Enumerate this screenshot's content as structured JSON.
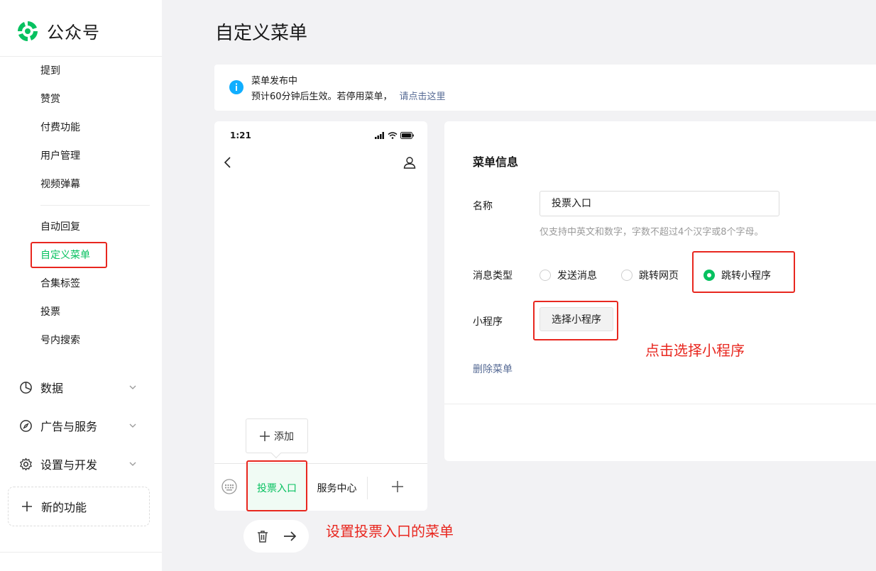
{
  "brand": {
    "name": "公众号",
    "color": "#07c160",
    "logo_icon": "wechat-official-logo"
  },
  "sidebar": {
    "items": [
      {
        "label": "提到",
        "active": false
      },
      {
        "label": "赞赏",
        "active": false
      },
      {
        "label": "付费功能",
        "active": false
      },
      {
        "label": "用户管理",
        "active": false
      },
      {
        "label": "视频弹幕",
        "active": false
      },
      {
        "label": "自动回复",
        "active": false
      },
      {
        "label": "自定义菜单",
        "active": true
      },
      {
        "label": "合集标签",
        "active": false
      },
      {
        "label": "投票",
        "active": false
      },
      {
        "label": "号内搜索",
        "active": false
      }
    ],
    "sections": [
      {
        "label": "数据",
        "icon": "pie-chart-icon"
      },
      {
        "label": "广告与服务",
        "icon": "compass-icon"
      },
      {
        "label": "设置与开发",
        "icon": "gear-icon"
      }
    ],
    "new_feature": "新的功能"
  },
  "page": {
    "title": "自定义菜单"
  },
  "notice": {
    "title": "菜单发布中",
    "desc": "预计60分钟后生效。若停用菜单，",
    "link": "请点击这里"
  },
  "phone": {
    "time": "1:21",
    "menus": [
      {
        "label": "投票入口",
        "selected": true
      },
      {
        "label": "服务中心",
        "selected": false
      }
    ],
    "add_label": "添加"
  },
  "form": {
    "section_title": "菜单信息",
    "name_label": "名称",
    "name_value": "投票入口",
    "name_hint": "仅支持中英文和数字，字数不超过4个汉字或8个字母。",
    "type_label": "消息类型",
    "types": [
      {
        "label": "发送消息",
        "checked": false
      },
      {
        "label": "跳转网页",
        "checked": false
      },
      {
        "label": "跳转小程序",
        "checked": true
      }
    ],
    "miniprogram_label": "小程序",
    "miniprogram_button": "选择小程序",
    "delete_link": "删除菜单"
  },
  "annotations": {
    "select_miniprogram": "点击选择小程序",
    "set_menu": "设置投票入口的菜单"
  },
  "colors": {
    "accent": "#07c160",
    "link": "#576b95",
    "annotation": "#e8271f",
    "info": "#10aeff"
  }
}
